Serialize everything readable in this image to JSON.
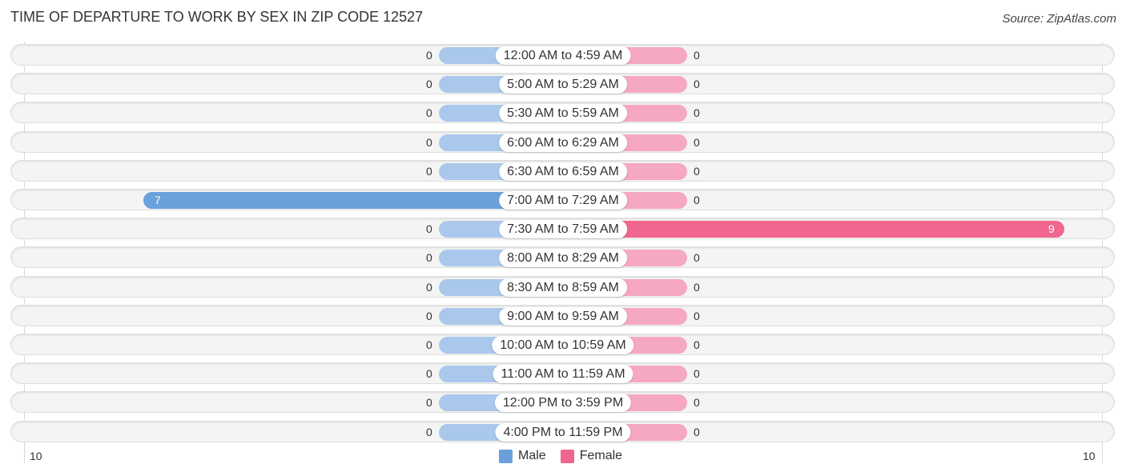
{
  "header": {
    "title": "TIME OF DEPARTURE TO WORK BY SEX IN ZIP CODE 12527",
    "source": "Source: ZipAtlas.com"
  },
  "colors": {
    "male_strong": "#6aa0dc",
    "male_light": "#a9c8eb",
    "female_strong": "#f0668e",
    "female_light": "#f5a8c0"
  },
  "chart_data": {
    "type": "bar",
    "orientation": "horizontal-diverging",
    "title": "TIME OF DEPARTURE TO WORK BY SEX IN ZIP CODE 12527",
    "categories": [
      "12:00 AM to 4:59 AM",
      "5:00 AM to 5:29 AM",
      "5:30 AM to 5:59 AM",
      "6:00 AM to 6:29 AM",
      "6:30 AM to 6:59 AM",
      "7:00 AM to 7:29 AM",
      "7:30 AM to 7:59 AM",
      "8:00 AM to 8:29 AM",
      "8:30 AM to 8:59 AM",
      "9:00 AM to 9:59 AM",
      "10:00 AM to 10:59 AM",
      "11:00 AM to 11:59 AM",
      "12:00 PM to 3:59 PM",
      "4:00 PM to 11:59 PM"
    ],
    "series": [
      {
        "name": "Male",
        "values": [
          0,
          0,
          0,
          0,
          0,
          7,
          0,
          0,
          0,
          0,
          0,
          0,
          0,
          0
        ]
      },
      {
        "name": "Female",
        "values": [
          0,
          0,
          0,
          0,
          0,
          0,
          9,
          0,
          0,
          0,
          0,
          0,
          0,
          0
        ]
      }
    ],
    "xlim": [
      -10,
      10
    ],
    "tick_labels": {
      "left": "10",
      "right": "10"
    },
    "legend": {
      "position": "bottom-center",
      "entries": [
        "Male",
        "Female"
      ]
    },
    "xlabel": "",
    "ylabel": ""
  }
}
